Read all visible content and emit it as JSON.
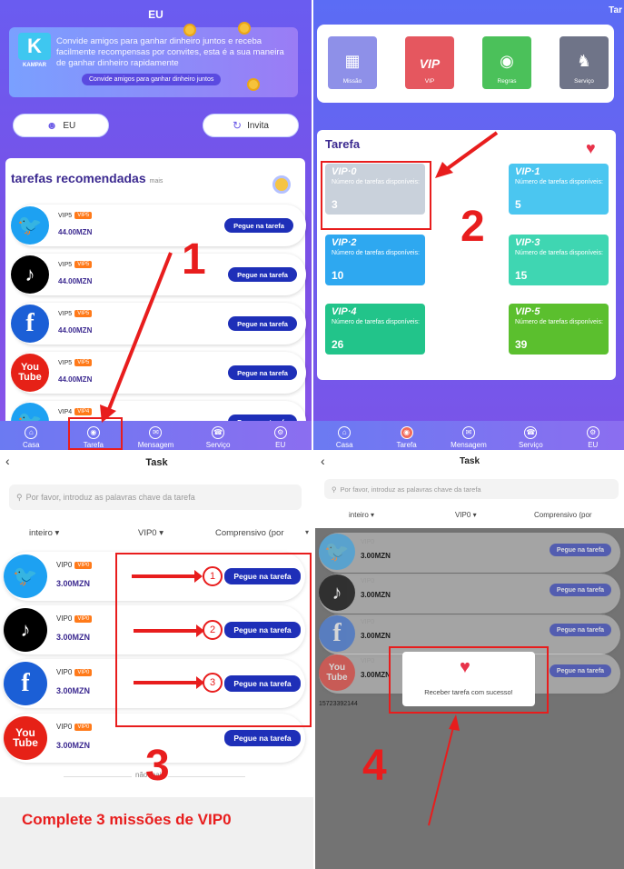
{
  "panel1": {
    "title": "EU",
    "banner_logo": "K",
    "banner_logo_sub": "KAMPAR",
    "banner_text": "Convide amigos para ganhar dinheiro juntos e receba facilmente recompensas por convites, esta é a sua maneira de ganhar dinheiro rapidamente",
    "banner_button": "Convide amigos para ganhar dinheiro juntos",
    "user_button": "EU",
    "invite_button": "Invita",
    "section_title": "tarefas recomendadas",
    "section_more": "mais",
    "tasks": [
      {
        "platform": "twitter",
        "level": "VIP5",
        "badge": "VIP5",
        "amount": "44.00MZN",
        "button": "Pegue na tarefa"
      },
      {
        "platform": "tiktok",
        "level": "VIP5",
        "badge": "VIP5",
        "amount": "44.00MZN",
        "button": "Pegue na tarefa"
      },
      {
        "platform": "facebook",
        "level": "VIP5",
        "badge": "VIP5",
        "amount": "44.00MZN",
        "button": "Pegue na tarefa"
      },
      {
        "platform": "youtube",
        "level": "VIP5",
        "badge": "VIP5",
        "amount": "44.00MZN",
        "button": "Pegue na tarefa"
      },
      {
        "platform": "twitter",
        "level": "VIP4",
        "badge": "VIP4",
        "amount": "",
        "button": "Pegue na tarefa"
      }
    ],
    "step_number": "1"
  },
  "panel2": {
    "title": "Tar",
    "tiles": [
      "Missão",
      "VIP",
      "Regras",
      "Serviço"
    ],
    "tile_vip_glyph": "VIP",
    "task_title": "Tarefa",
    "vip_levels": [
      {
        "label": "VIP·0",
        "desc": "Número de tarefas disponíveis:",
        "count": "3"
      },
      {
        "label": "VIP·1",
        "desc": "Número de tarefas disponíveis:",
        "count": "5"
      },
      {
        "label": "VIP·2",
        "desc": "Número de tarefas disponíveis:",
        "count": "10"
      },
      {
        "label": "VIP·3",
        "desc": "Número de tarefas disponíveis:",
        "count": "15"
      },
      {
        "label": "VIP·4",
        "desc": "Número de tarefas disponíveis:",
        "count": "26"
      },
      {
        "label": "VIP·5",
        "desc": "Número de tarefas disponíveis:",
        "count": "39"
      }
    ],
    "step_number": "2"
  },
  "nav": [
    "Casa",
    "Tarefa",
    "Mensagem",
    "Serviço",
    "EU"
  ],
  "panel3": {
    "title": "Task",
    "search_placeholder": "Por favor, introduz as palavras chave da tarefa",
    "filters": [
      "inteiro ▾",
      "VIP0 ▾",
      "Comprensivo (por"
    ],
    "tasks": [
      {
        "platform": "twitter",
        "level": "VIP0",
        "badge": "VIP0",
        "amount": "3.00MZN",
        "button": "Pegue na tarefa",
        "marker": "1"
      },
      {
        "platform": "tiktok",
        "level": "VIP0",
        "badge": "VIP0",
        "amount": "3.00MZN",
        "button": "Pegue na tarefa",
        "marker": "2"
      },
      {
        "platform": "facebook",
        "level": "VIP0",
        "badge": "VIP0",
        "amount": "3.00MZN",
        "button": "Pegue na tarefa",
        "marker": "3"
      },
      {
        "platform": "youtube",
        "level": "VIP0",
        "badge": "VIP0",
        "amount": "3.00MZN",
        "button": "Pegue na tarefa",
        "marker": ""
      }
    ],
    "no_more": "não mais",
    "step_number": "3",
    "instruction": "Complete 3 missões de VIP0"
  },
  "panel4": {
    "title": "Task",
    "search_placeholder": "Por favor, introduz as palavras chave da tarefa",
    "filters": [
      "inteiro ▾",
      "VIP0 ▾",
      "Comprensivo (por"
    ],
    "amounts": [
      "3.00MZN",
      "3.00MZN",
      "3.00MZN",
      "3.00MZN"
    ],
    "levels": [
      "VIP0",
      "VIP0",
      "VIP0",
      "VIP0"
    ],
    "button": "Pegue na tarefa",
    "phone": "15723392144",
    "modal_text": "Receber tarefa com sucesso!",
    "step_number": "4"
  },
  "colors": {
    "accent": "#1e2fb8",
    "annotation": "#e81d1d",
    "purple": "#6a5cf0",
    "badge": "#ff7a1a"
  },
  "icons": {
    "twitter": "twitter-icon",
    "tiktok": "tiktok-icon",
    "facebook": "facebook-icon",
    "youtube": "youtube-icon"
  }
}
